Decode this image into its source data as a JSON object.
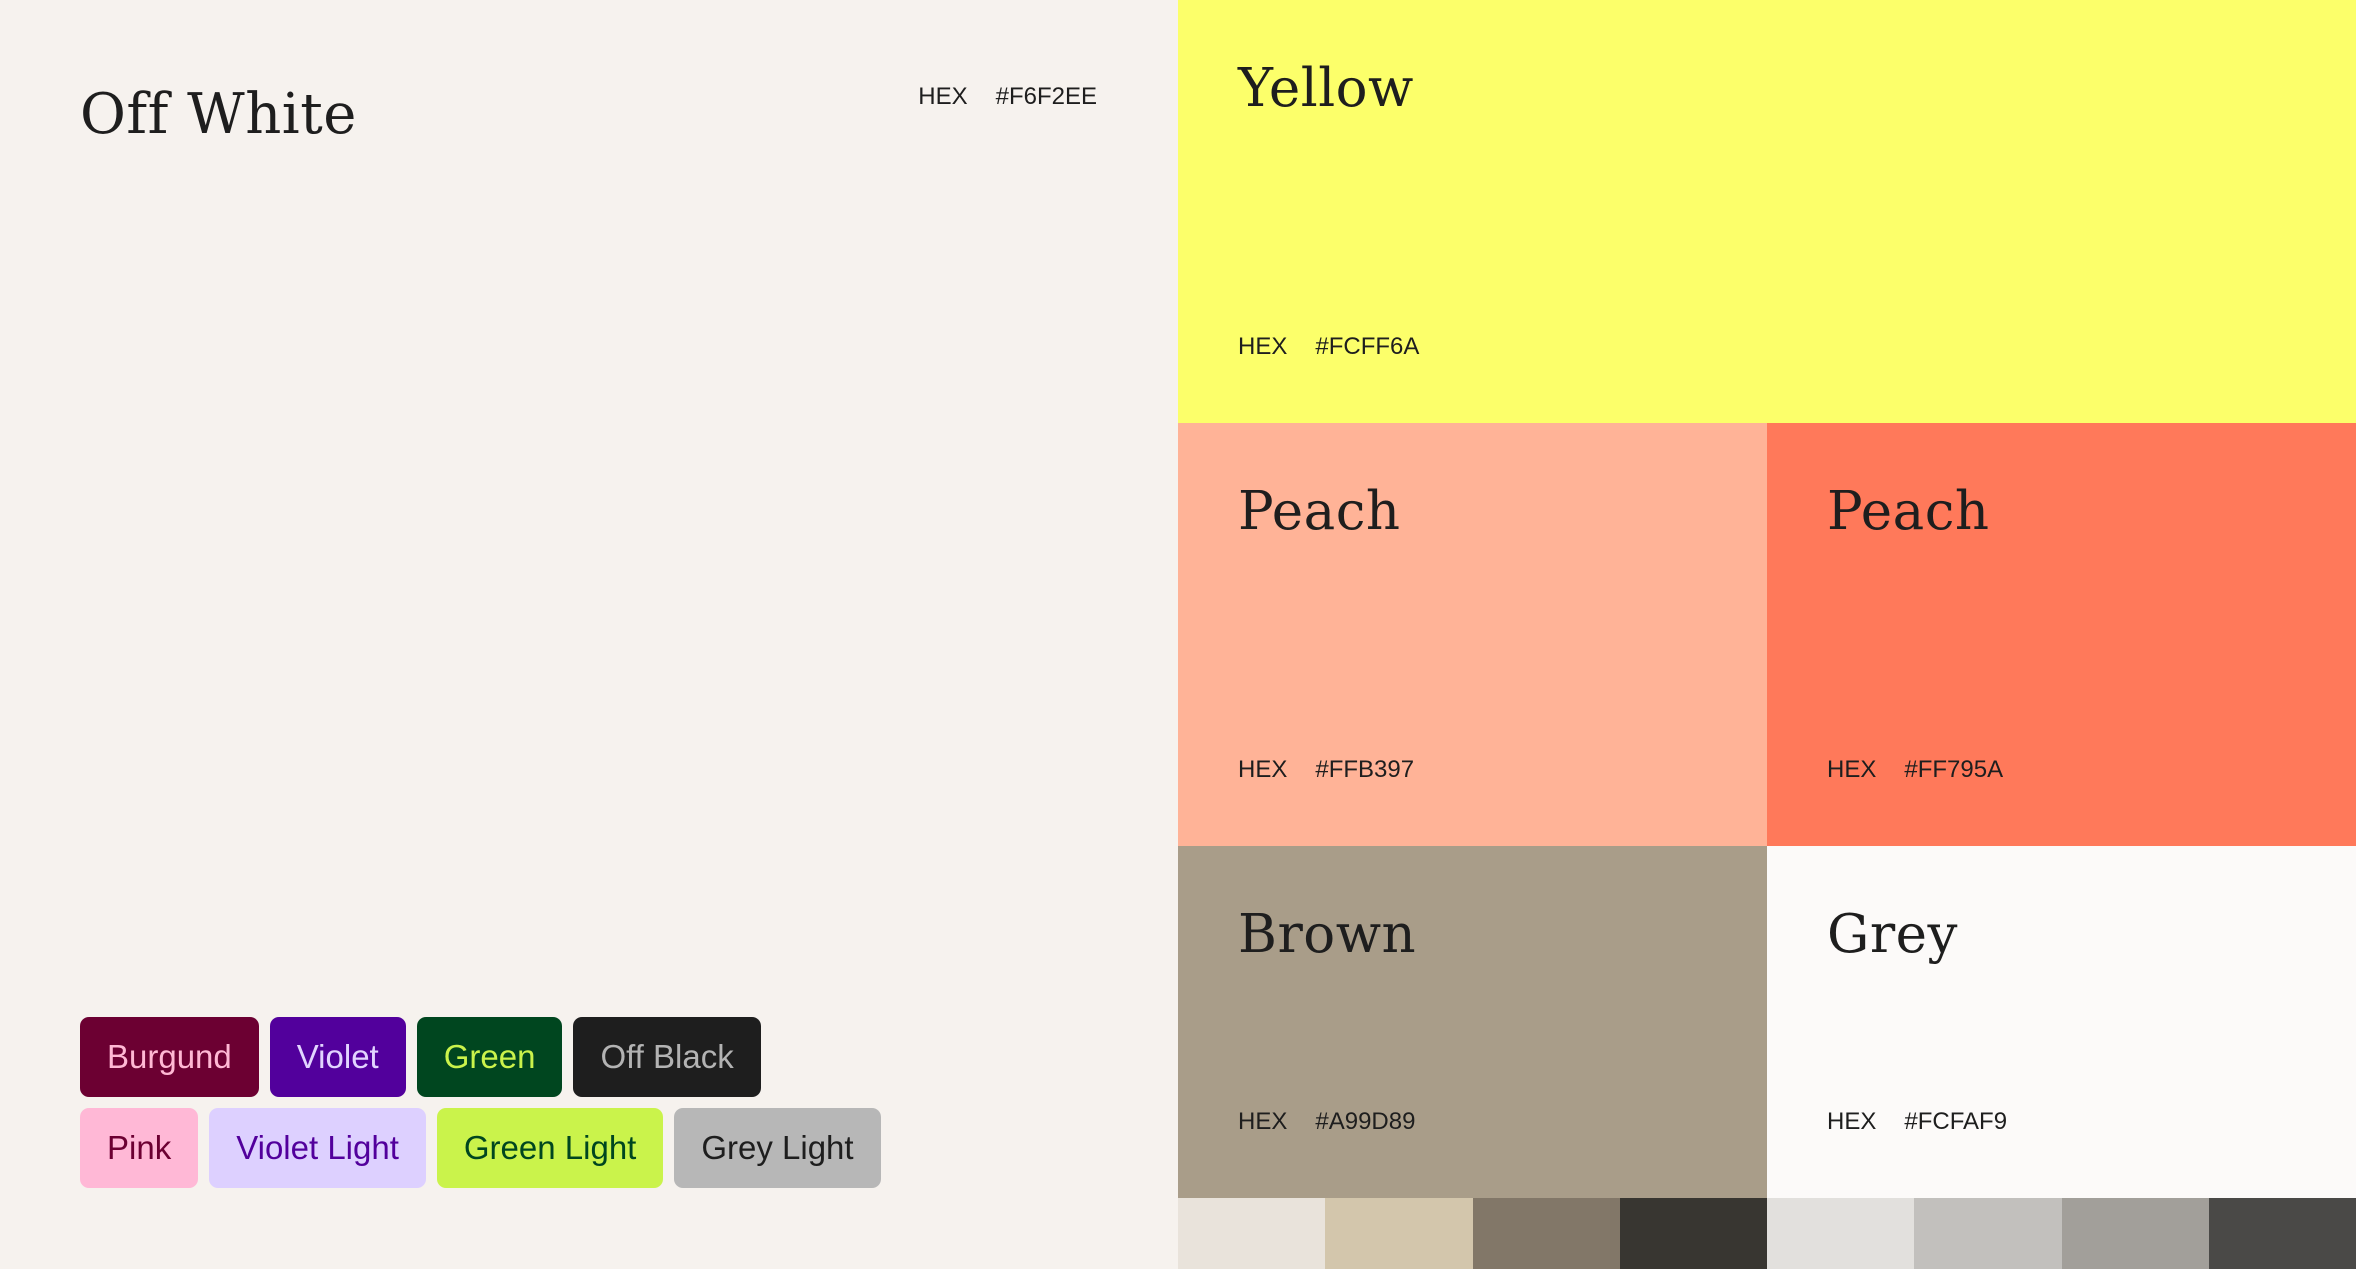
{
  "main": {
    "name": "Off White",
    "hex_label": "HEX",
    "hex": "#F6F2EE",
    "color": "#F6F2EE"
  },
  "chips_row1": [
    {
      "label": "Burgund",
      "bg": "#6C0032",
      "fg": "#FFB8D4"
    },
    {
      "label": "Violet",
      "bg": "#52009C",
      "fg": "#E2D4FF"
    },
    {
      "label": "Green",
      "bg": "#00461F",
      "fg": "#CAF34B"
    },
    {
      "label": "Off Black",
      "bg": "#1E1E1E",
      "fg": "#B3B3B3"
    }
  ],
  "chips_row2": [
    {
      "label": "Pink",
      "bg": "#FFB8D6",
      "fg": "#6C0032"
    },
    {
      "label": "Violet Light",
      "bg": "#DDD0FF",
      "fg": "#52009C"
    },
    {
      "label": "Green Light",
      "bg": "#CAF34B",
      "fg": "#00461F"
    },
    {
      "label": "Grey Light",
      "bg": "#B7B7B7",
      "fg": "#1E1E1E"
    }
  ],
  "swatches": {
    "yellow": {
      "name": "Yellow",
      "hex_label": "HEX",
      "hex": "#FCFF6A"
    },
    "peach1": {
      "name": "Peach",
      "hex_label": "HEX",
      "hex": "#FFB397"
    },
    "peach2": {
      "name": "Peach",
      "hex_label": "HEX",
      "hex": "#FF795A"
    },
    "brown": {
      "name": "Brown",
      "hex_label": "HEX",
      "hex": "#A99D89"
    },
    "grey": {
      "name": "Grey",
      "hex_label": "HEX",
      "hex": "#FCFAF9"
    }
  },
  "tints": [
    "#E9E3DB",
    "#D3C6AC",
    "#827768",
    "#383631",
    "#E2E0DD",
    "#C2C0BD",
    "#A29F9A",
    "#4A4947"
  ]
}
